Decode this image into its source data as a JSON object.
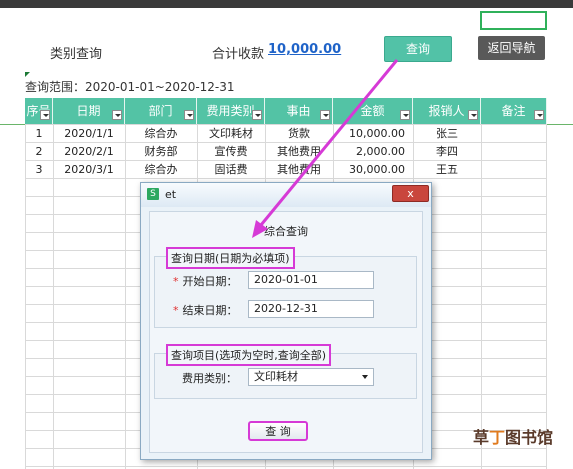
{
  "header": {
    "category_query_label": "类别查询",
    "total_label": "合计收款",
    "total_value": "10,000.00",
    "query_button": "查询",
    "back_button": "返回导航",
    "range_text": "查询范围：2020-01-01~2020-12-31"
  },
  "table": {
    "columns": [
      "序号",
      "日期",
      "部门",
      "费用类别",
      "事由",
      "金额",
      "报销人",
      "备注"
    ],
    "rows": [
      [
        "1",
        "2020/1/1",
        "综合办",
        "文印耗材",
        "货款",
        "10,000.00",
        "张三",
        ""
      ],
      [
        "2",
        "2020/2/1",
        "财务部",
        "宣传费",
        "其他费用",
        "2,000.00",
        "李四",
        ""
      ],
      [
        "3",
        "2020/3/1",
        "综合办",
        "固话费",
        "其他费用",
        "30,000.00",
        "王五",
        ""
      ]
    ]
  },
  "dialog": {
    "app_icon": "S",
    "window_title": "et",
    "close_icon": "x",
    "heading": "综合查询",
    "date_group_label": "查询日期(日期为必填项)",
    "start_label": "开始日期：",
    "start_value": "2020-01-01",
    "end_label": "结束日期：",
    "end_value": "2020-12-31",
    "item_group_label": "查询项目(选项为空时,查询全部)",
    "category_label": "费用类别：",
    "category_value": "文印耗材",
    "submit_button": "查 询"
  },
  "watermark": {
    "part1": "草",
    "part2": "丁",
    "part3": "图书馆"
  },
  "colors": {
    "header_green": "#53c3a5",
    "highlight_magenta": "#d63ad6",
    "link_blue": "#1f63c8"
  }
}
